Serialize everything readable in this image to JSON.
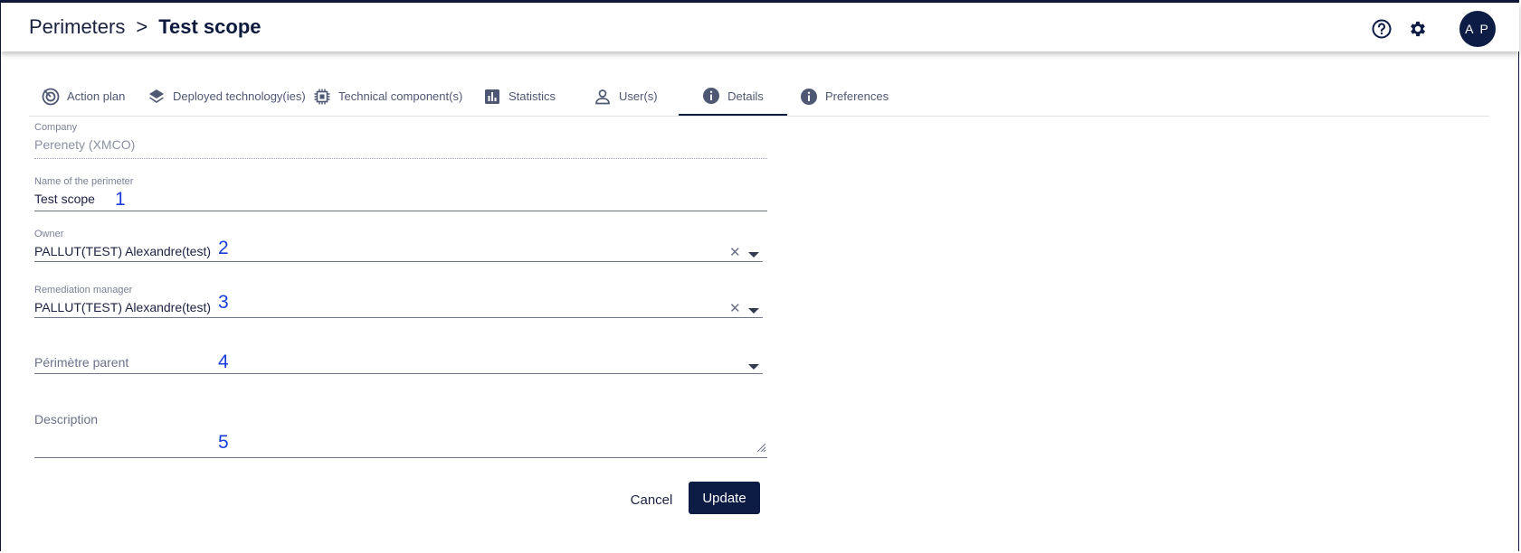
{
  "header": {
    "breadcrumb_root": "Perimeters",
    "breadcrumb_sep": ">",
    "breadcrumb_current": "Test scope",
    "avatar_initials": "A P",
    "icons": [
      "help-icon",
      "settings-gear-icon"
    ]
  },
  "tabs": [
    {
      "label": "Action plan",
      "icon": "target-icon"
    },
    {
      "label": "Deployed technology(ies)",
      "icon": "layers-icon"
    },
    {
      "label": "Technical component(s)",
      "icon": "chip-icon"
    },
    {
      "label": "Statistics",
      "icon": "bar-chart-icon"
    },
    {
      "label": "User(s)",
      "icon": "user-icon"
    },
    {
      "label": "Details",
      "icon": "info-icon",
      "active": true
    },
    {
      "label": "Preferences",
      "icon": "info-icon"
    }
  ],
  "form": {
    "company": {
      "label": "Company",
      "value": "Perenety (XMCO)"
    },
    "name": {
      "label": "Name of the perimeter",
      "value": "Test scope"
    },
    "owner": {
      "label": "Owner",
      "value": "PALLUT(TEST) Alexandre(test)"
    },
    "remediation": {
      "label": "Remediation manager",
      "value": "PALLUT(TEST) Alexandre(test)"
    },
    "parent": {
      "placeholder": "Périmètre parent"
    },
    "description": {
      "label": "Description",
      "value": ""
    }
  },
  "annotations": [
    "1",
    "2",
    "3",
    "4",
    "5"
  ],
  "actions": {
    "cancel": "Cancel",
    "update": "Update"
  },
  "colors": {
    "primary": "#0d1c44",
    "annotation": "#1a3fd9"
  }
}
